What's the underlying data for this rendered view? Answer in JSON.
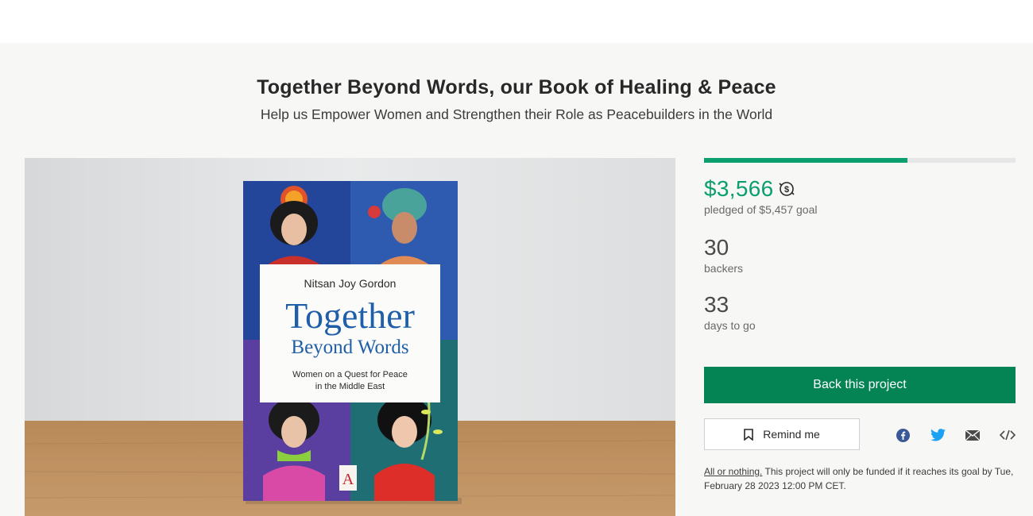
{
  "project": {
    "title": "Together Beyond Words, our Book of Healing & Peace",
    "subtitle": "Help us Empower Women and Strengthen their Role as Peacebuilders in the World"
  },
  "book_cover": {
    "author": "Nitsan Joy Gordon",
    "title_line1": "Together",
    "title_line2": "Beyond Words",
    "tagline_line1": "Women on a Quest for Peace",
    "tagline_line2": "in the Middle East",
    "publisher_mark": "A"
  },
  "funding": {
    "progress_fraction": 0.653,
    "amount": "$3,566",
    "amount_caption": "pledged of $5,457 goal",
    "backers": "30",
    "backers_caption": "backers",
    "days": "33",
    "days_caption": "days to go"
  },
  "actions": {
    "back_label": "Back this project",
    "remind_label": "Remind me"
  },
  "share_icons": [
    "facebook-icon",
    "twitter-icon",
    "email-icon",
    "embed-icon"
  ],
  "note": {
    "link": "All or nothing.",
    "text": " This project will only be funded if it reaches its goal by Tue, February 28 2023 12:00 PM CET."
  },
  "colors": {
    "accent": "#0b9e6e",
    "button": "#048454",
    "facebook": "#3b5998",
    "twitter": "#1da1f2"
  }
}
